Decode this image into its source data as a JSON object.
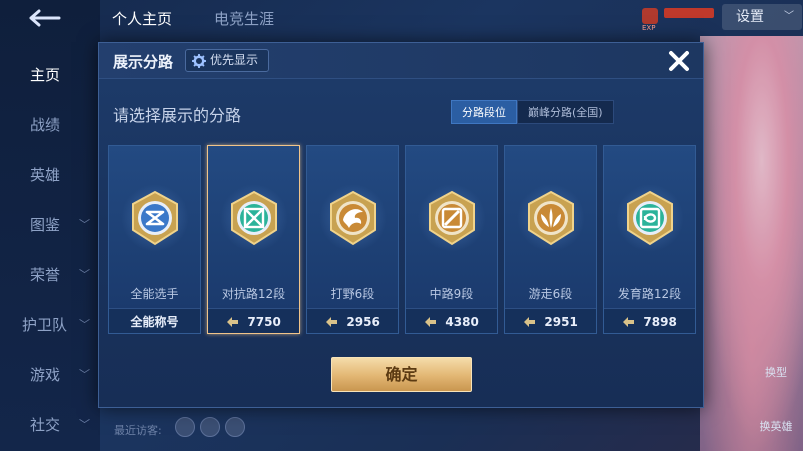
{
  "nav": {
    "back_icon": "back-arrow-icon",
    "items": [
      {
        "label": "主页",
        "active": true,
        "has_chevron": false
      },
      {
        "label": "战绩",
        "active": false,
        "has_chevron": false
      },
      {
        "label": "英雄",
        "active": false,
        "has_chevron": false
      },
      {
        "label": "图鉴",
        "active": false,
        "has_chevron": true
      },
      {
        "label": "荣誉",
        "active": false,
        "has_chevron": true
      },
      {
        "label": "护卫队",
        "active": false,
        "has_chevron": true
      },
      {
        "label": "游戏",
        "active": false,
        "has_chevron": true
      },
      {
        "label": "社交",
        "active": false,
        "has_chevron": true
      }
    ]
  },
  "top_tabs": [
    {
      "label": "个人主页",
      "active": true
    },
    {
      "label": "电竞生涯",
      "active": false
    }
  ],
  "settings_label": "设置",
  "exp_badge_text": "EXP",
  "bottom": {
    "recent_visitors_label": "最近访客:",
    "right_top_label": "换型",
    "right_bottom_label": "换英雄"
  },
  "modal": {
    "title": "展示分路",
    "priority_label": "优先显示",
    "subtitle": "请选择展示的分路",
    "segments": [
      {
        "label": "分路段位",
        "active": true
      },
      {
        "label": "巅峰分路(全国)",
        "active": false
      }
    ],
    "cards": [
      {
        "name": "全能选手",
        "footer": "全能称号",
        "points": null,
        "icon": "all-round-emblem-icon",
        "accent": "#3a78c9",
        "selected": false
      },
      {
        "name": "对抗路12段",
        "footer": "7750",
        "points": 7750,
        "icon": "clash-lane-emblem-icon",
        "accent": "#2bb39a",
        "selected": true
      },
      {
        "name": "打野6段",
        "footer": "2956",
        "points": 2956,
        "icon": "jungle-emblem-icon",
        "accent": "#c98a36",
        "selected": false
      },
      {
        "name": "中路9段",
        "footer": "4380",
        "points": 4380,
        "icon": "mid-lane-emblem-icon",
        "accent": "#c98a36",
        "selected": false
      },
      {
        "name": "游走6段",
        "footer": "2951",
        "points": 2951,
        "icon": "roam-emblem-icon",
        "accent": "#c98a36",
        "selected": false
      },
      {
        "name": "发育路12段",
        "footer": "7898",
        "points": 7898,
        "icon": "farm-lane-emblem-icon",
        "accent": "#2bb39a",
        "selected": false
      }
    ],
    "confirm_label": "确定",
    "close_icon": "close-icon"
  },
  "colors": {
    "modal_bg": "#1d3a68",
    "selected_border": "#f0c48a",
    "confirm_gold": "#e2b673",
    "segment_active": "#2b5ea3"
  }
}
